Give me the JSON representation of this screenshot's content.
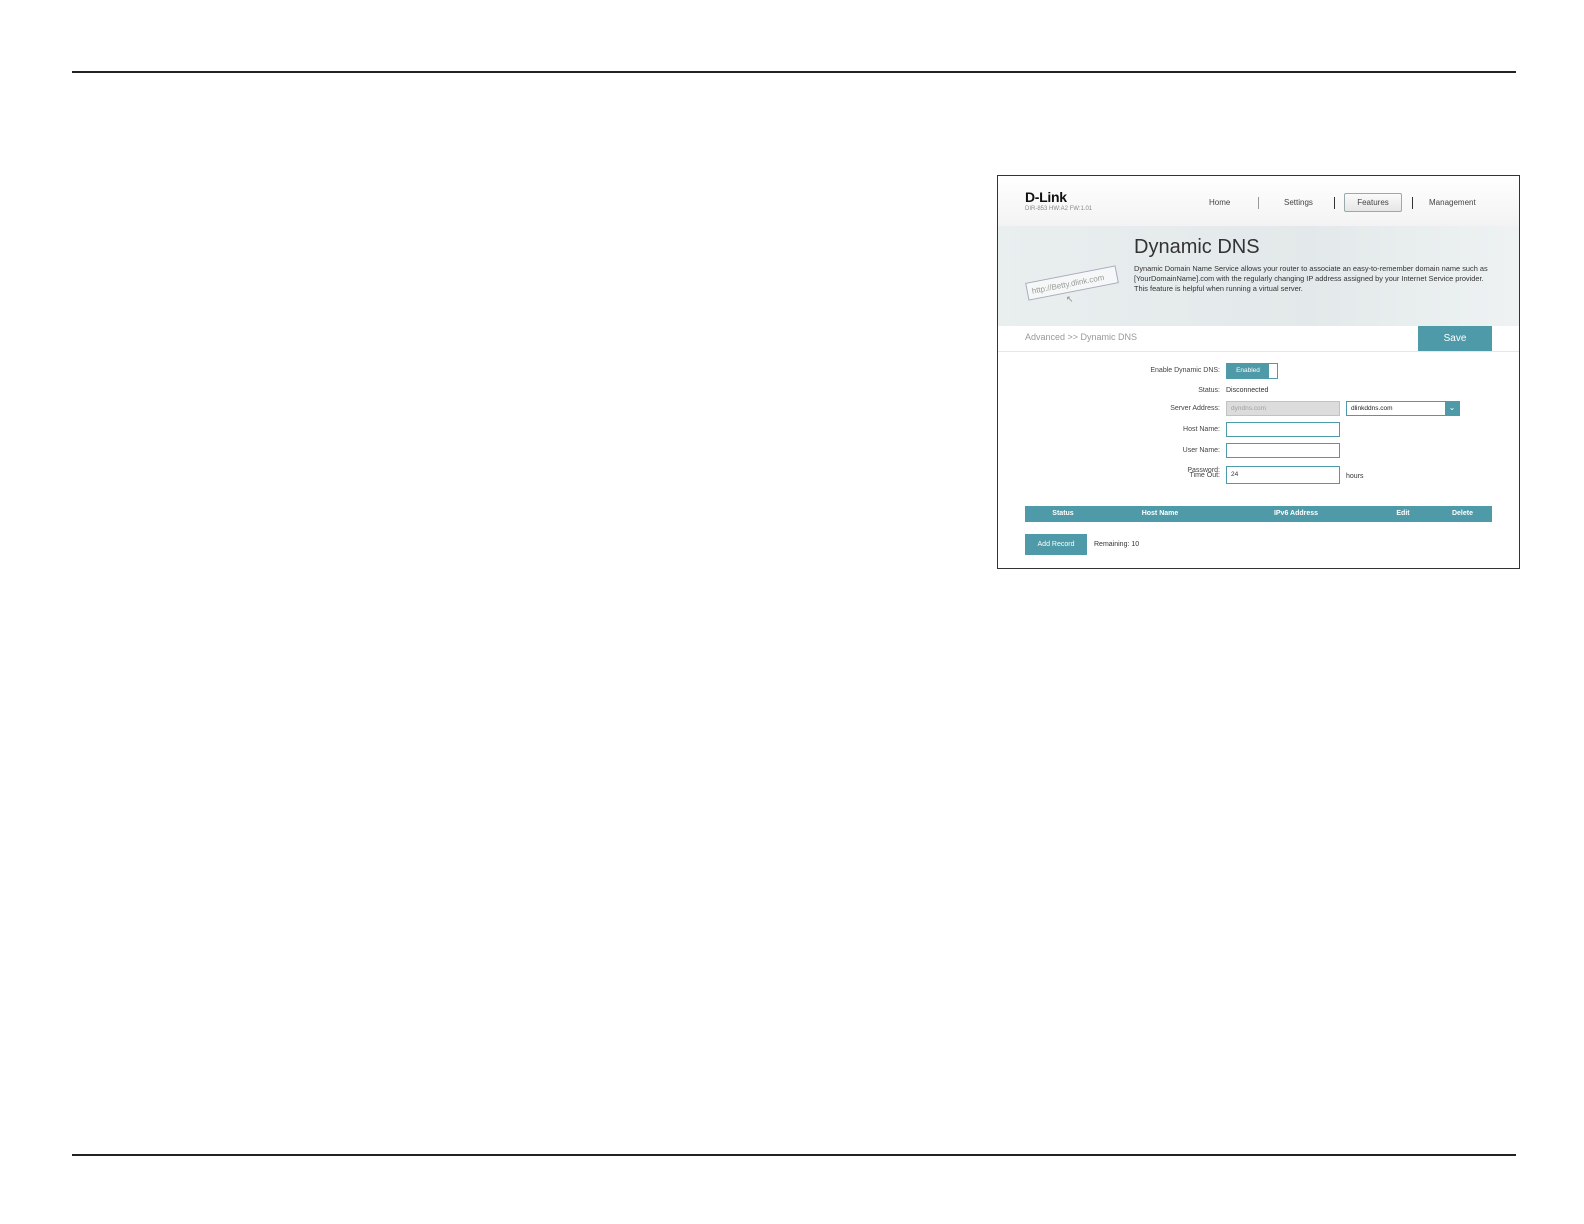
{
  "header": {
    "logo": "D-Link",
    "model": "DIR-853 HW:A2 FW:1.01",
    "nav": {
      "home": "Home",
      "settings": "Settings",
      "features": "Features",
      "management": "Management"
    }
  },
  "banner": {
    "title": "Dynamic DNS",
    "description": "Dynamic Domain Name Service allows your router to associate an easy-to-remember domain name such as [YourDomainName].com with the regularly changing IP address assigned by your Internet Service provider. This feature is helpful when running a virtual server.",
    "url_graphic": "http://Betty.dlink.com"
  },
  "breadcrumb": "Advanced >> Dynamic DNS",
  "save_label": "Save",
  "form": {
    "enable_label": "Enable Dynamic DNS:",
    "enable_value": "Enabled",
    "status_label": "Status:",
    "status_value": "Disconnected",
    "server_label": "Server Address:",
    "server_placeholder": "dyndns.com",
    "server_select": "dlinkddns.com",
    "host_label": "Host Name:",
    "host_value": "",
    "user_label": "User Name:",
    "user_value": "",
    "password_label": "Password:",
    "timeout_label": "Time Out:",
    "timeout_value": "24",
    "timeout_unit": "hours"
  },
  "table": {
    "columns": [
      "Status",
      "Host Name",
      "IPv6 Address",
      "Edit",
      "Delete"
    ]
  },
  "add_record_label": "Add Record",
  "remaining": "Remaining: 10",
  "colors": {
    "accent": "#4e9aa8"
  }
}
